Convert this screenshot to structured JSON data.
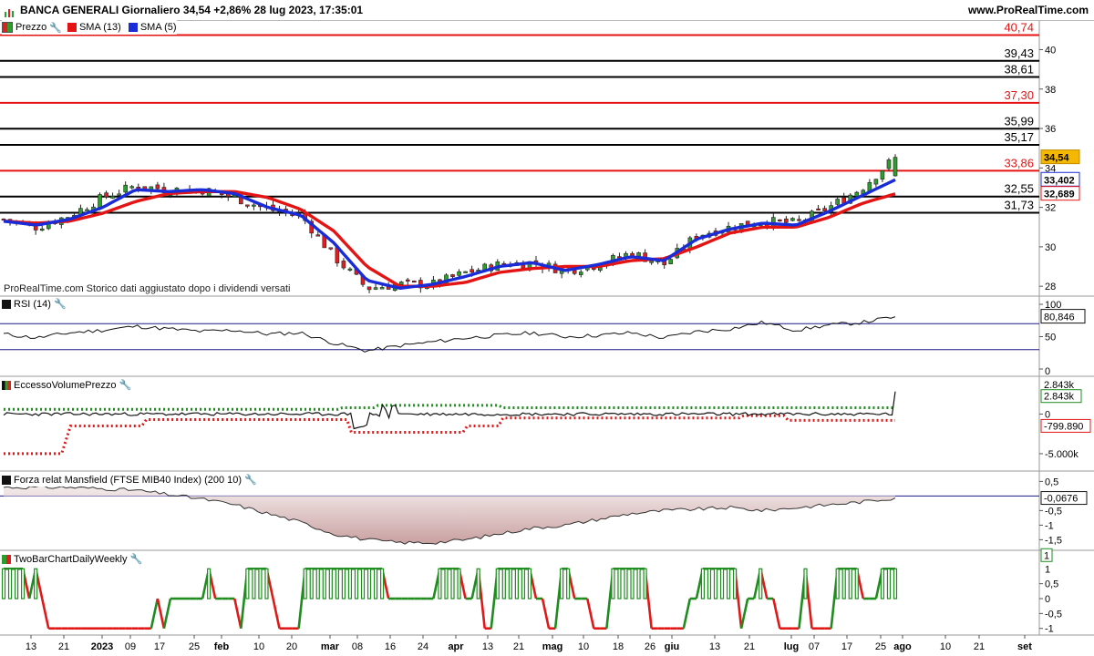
{
  "header": {
    "title": "BANCA GENERALI Giornaliero 34,54 +2,86% 28 lug 2023, 17:35:01",
    "site": "www.ProRealTime.com"
  },
  "colors": {
    "up": "#2e9c2e",
    "down": "#e02020",
    "sma13": "#e41414",
    "sma5": "#1a2bd8",
    "rsi_line": "#1a1a8c",
    "mansfield_fill": "#c9a0a0",
    "twobar_up": "#1e8c1e",
    "twobar_down": "#e01818"
  },
  "legend": {
    "price": "Prezzo",
    "sma13": "SMA (13)",
    "sma5": "SMA (5)"
  },
  "watermark": "ProRealTime.com  Storico dati aggiustato dopo i dividendi versati",
  "price_panel": {
    "y_ticks": [
      "40",
      "38",
      "36",
      "34",
      "32",
      "30",
      "28"
    ],
    "levels": [
      {
        "value": 40.74,
        "label": "40,74",
        "color": "red"
      },
      {
        "value": 39.43,
        "label": "39,43",
        "color": "black"
      },
      {
        "value": 38.61,
        "label": "38,61",
        "color": "black"
      },
      {
        "value": 37.3,
        "label": "37,30",
        "color": "red"
      },
      {
        "value": 35.99,
        "label": "35,99",
        "color": "black"
      },
      {
        "value": 35.17,
        "label": "35,17",
        "color": "black"
      },
      {
        "value": 33.86,
        "label": "33,86",
        "color": "red"
      },
      {
        "value": 32.55,
        "label": "32,55",
        "color": "black"
      },
      {
        "value": 31.73,
        "label": "31,73",
        "color": "black"
      }
    ],
    "last_price_label": "34,54",
    "sma5_label": "33,402",
    "sma13_label": "32,689"
  },
  "rsi": {
    "title": "RSI (14)",
    "ticks": [
      "100",
      "50",
      "0"
    ],
    "value_label": "80,846"
  },
  "evp": {
    "title": "EccessoVolumePrezzo",
    "ticks": [
      "0",
      "-5.000k"
    ],
    "upper_label": "2.843k",
    "value_label": "2.843k",
    "lower_label": "-799.890"
  },
  "mansfield": {
    "title": "Forza relat Mansfield (FTSE MIB40 Index) (200 10)",
    "ticks": [
      "0,5",
      "-0,5",
      "-1",
      "-1,5"
    ],
    "value_label": "-0,0676"
  },
  "twobar": {
    "title": "TwoBarChartDailyWeekly",
    "ticks": [
      "1",
      "0,5",
      "0",
      "-0,5",
      "-1"
    ],
    "value_label": "1"
  },
  "x_axis": {
    "labels": [
      {
        "text": "13",
        "bold": false
      },
      {
        "text": "21",
        "bold": false
      },
      {
        "text": "2023",
        "bold": true
      },
      {
        "text": "09",
        "bold": false
      },
      {
        "text": "17",
        "bold": false
      },
      {
        "text": "25",
        "bold": false
      },
      {
        "text": "feb",
        "bold": true
      },
      {
        "text": "10",
        "bold": false
      },
      {
        "text": "20",
        "bold": false
      },
      {
        "text": "mar",
        "bold": true
      },
      {
        "text": "08",
        "bold": false
      },
      {
        "text": "16",
        "bold": false
      },
      {
        "text": "24",
        "bold": false
      },
      {
        "text": "apr",
        "bold": true
      },
      {
        "text": "13",
        "bold": false
      },
      {
        "text": "21",
        "bold": false
      },
      {
        "text": "mag",
        "bold": true
      },
      {
        "text": "10",
        "bold": false
      },
      {
        "text": "18",
        "bold": false
      },
      {
        "text": "26",
        "bold": false
      },
      {
        "text": "giu",
        "bold": true
      },
      {
        "text": "13",
        "bold": false
      },
      {
        "text": "21",
        "bold": false
      },
      {
        "text": "lug",
        "bold": true
      },
      {
        "text": "07",
        "bold": false
      },
      {
        "text": "17",
        "bold": false
      },
      {
        "text": "25",
        "bold": false
      },
      {
        "text": "ago",
        "bold": true
      },
      {
        "text": "10",
        "bold": false
      },
      {
        "text": "21",
        "bold": false
      },
      {
        "text": "set",
        "bold": true
      }
    ]
  },
  "chart_data": [
    {
      "type": "line",
      "title": "BANCA GENERALI Giornaliero",
      "x": [
        "13",
        "21",
        "2023",
        "09",
        "17",
        "25",
        "feb",
        "10",
        "20",
        "mar",
        "08",
        "16",
        "24",
        "apr",
        "13",
        "21",
        "mag",
        "10",
        "18",
        "26",
        "giu",
        "13",
        "21",
        "lug",
        "07",
        "17",
        "25",
        "28 lug"
      ],
      "series": [
        {
          "name": "Prezzo",
          "values": [
            31.4,
            31.0,
            31.6,
            32.5,
            33.1,
            32.9,
            32.9,
            32.5,
            31.9,
            31.6,
            29.5,
            27.9,
            28.1,
            28.1,
            28.7,
            29.1,
            29.2,
            28.8,
            29.1,
            29.7,
            29.1,
            30.6,
            31.0,
            31.3,
            31.2,
            32.0,
            33.0,
            34.54
          ]
        },
        {
          "name": "SMA (13)",
          "values": [
            31.3,
            31.2,
            31.3,
            31.7,
            32.3,
            32.7,
            32.8,
            32.8,
            32.5,
            31.9,
            30.8,
            29.0,
            28.0,
            28.0,
            28.2,
            28.7,
            28.9,
            29.0,
            29.0,
            29.3,
            29.4,
            30.0,
            30.7,
            31.0,
            31.0,
            31.5,
            32.2,
            32.689
          ]
        },
        {
          "name": "SMA (5)",
          "values": [
            31.3,
            31.1,
            31.4,
            32.0,
            32.9,
            32.8,
            32.9,
            32.7,
            32.0,
            31.6,
            30.2,
            28.3,
            27.9,
            28.1,
            28.5,
            29.0,
            29.2,
            28.8,
            29.1,
            29.5,
            29.3,
            30.4,
            30.9,
            31.2,
            31.1,
            31.8,
            32.6,
            33.402
          ]
        }
      ],
      "ylim": [
        27.5,
        41.5
      ],
      "levels": [
        40.74,
        39.43,
        38.61,
        37.3,
        35.99,
        35.17,
        33.86,
        32.55,
        31.73
      ]
    },
    {
      "type": "line",
      "title": "RSI (14)",
      "series": [
        {
          "name": "RSI (14)",
          "values": [
            54,
            48,
            56,
            60,
            66,
            62,
            58,
            60,
            54,
            56,
            40,
            28,
            36,
            42,
            48,
            52,
            56,
            50,
            52,
            56,
            48,
            58,
            62,
            72,
            60,
            68,
            72,
            80.846
          ]
        }
      ],
      "ylim": [
        0,
        100
      ]
    },
    {
      "type": "line",
      "title": "EccessoVolumePrezzo",
      "series": [
        {
          "name": "EccessoVolumePrezzo",
          "values": [
            0,
            0,
            0,
            0,
            0,
            0,
            0,
            0,
            0,
            0,
            -2000,
            500,
            0,
            0,
            0,
            0,
            0,
            0,
            0,
            0,
            0,
            0,
            0,
            0,
            0,
            0,
            0,
            2843
          ]
        }
      ]
    },
    {
      "type": "area",
      "title": "Forza relat Mansfield (FTSE MIB40 Index) (200 10)",
      "series": [
        {
          "name": "Mansfield",
          "values": [
            0.3,
            0.3,
            0.3,
            0.25,
            0.2,
            0.05,
            -0.1,
            -0.3,
            -0.6,
            -0.9,
            -1.3,
            -1.5,
            -1.6,
            -1.6,
            -1.5,
            -1.3,
            -1.1,
            -1.0,
            -0.8,
            -0.6,
            -0.5,
            -0.45,
            -0.4,
            -0.5,
            -0.4,
            -0.3,
            -0.2,
            -0.0676
          ]
        }
      ],
      "ylim": [
        -1.8,
        0.7
      ]
    }
  ]
}
